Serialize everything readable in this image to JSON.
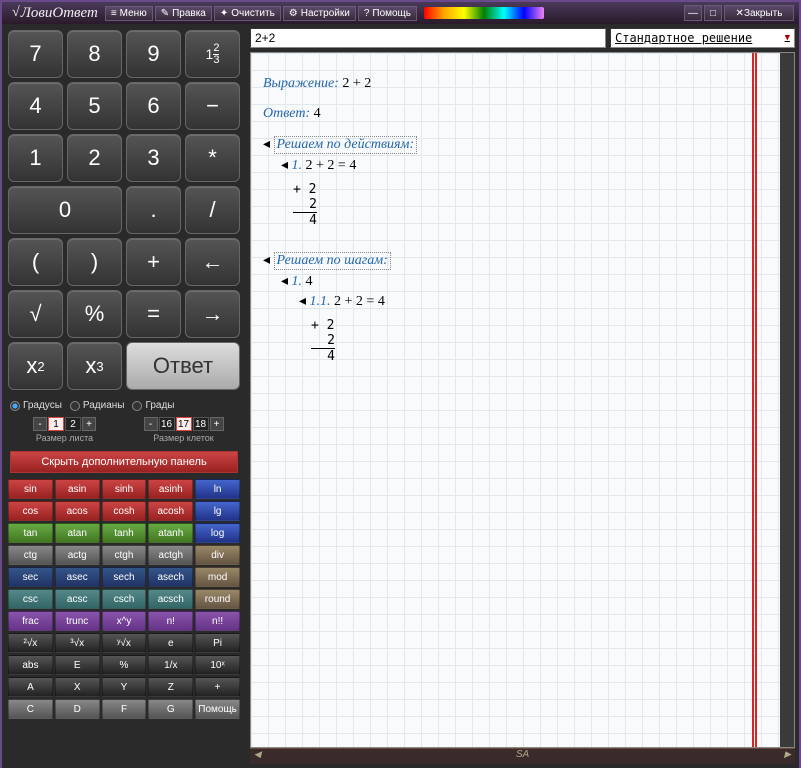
{
  "app": {
    "title": "ЛовиОтвет"
  },
  "menu": {
    "items": [
      "Меню",
      "Правка",
      "Очистить",
      "Настройки",
      "Помощь"
    ],
    "close": "Закрыть"
  },
  "keypad": {
    "rows": [
      [
        "7",
        "8",
        "9",
        "1⅔"
      ],
      [
        "4",
        "5",
        "6",
        "−"
      ],
      [
        "1",
        "2",
        "3",
        "*"
      ],
      [
        "0",
        "",
        ".",
        "/"
      ],
      [
        "(",
        ")",
        "+",
        "←"
      ],
      [
        "√",
        "%",
        "=",
        "→"
      ]
    ],
    "x2": "x",
    "x2_sup": "2",
    "x3": "x",
    "x3_sup": "3",
    "answer": "Ответ"
  },
  "angle": {
    "opts": [
      "Градусы",
      "Радианы",
      "Грады"
    ],
    "selected": 0
  },
  "sheet": {
    "label": "Размер листа",
    "vals": [
      "1",
      "2"
    ],
    "sel": 0
  },
  "cell": {
    "label": "Размер клеток",
    "vals": [
      "16",
      "17",
      "18"
    ],
    "sel": 1
  },
  "hide_panel": "Скрыть дополнительную панель",
  "fns": [
    [
      {
        "t": "sin",
        "c": "c-red"
      },
      {
        "t": "asin",
        "c": "c-red"
      },
      {
        "t": "sinh",
        "c": "c-red"
      },
      {
        "t": "asinh",
        "c": "c-red"
      },
      {
        "t": "ln",
        "c": "c-blue"
      }
    ],
    [
      {
        "t": "cos",
        "c": "c-red"
      },
      {
        "t": "acos",
        "c": "c-red"
      },
      {
        "t": "cosh",
        "c": "c-red"
      },
      {
        "t": "acosh",
        "c": "c-red"
      },
      {
        "t": "lg",
        "c": "c-blue"
      }
    ],
    [
      {
        "t": "tan",
        "c": "c-green"
      },
      {
        "t": "atan",
        "c": "c-green"
      },
      {
        "t": "tanh",
        "c": "c-green"
      },
      {
        "t": "atanh",
        "c": "c-green"
      },
      {
        "t": "log",
        "c": "c-blue"
      }
    ],
    [
      {
        "t": "ctg",
        "c": "c-gray"
      },
      {
        "t": "actg",
        "c": "c-gray"
      },
      {
        "t": "ctgh",
        "c": "c-gray"
      },
      {
        "t": "actgh",
        "c": "c-gray"
      },
      {
        "t": "div",
        "c": "c-brown"
      }
    ],
    [
      {
        "t": "sec",
        "c": "c-dblue"
      },
      {
        "t": "asec",
        "c": "c-dblue"
      },
      {
        "t": "sech",
        "c": "c-dblue"
      },
      {
        "t": "asech",
        "c": "c-dblue"
      },
      {
        "t": "mod",
        "c": "c-brown"
      }
    ],
    [
      {
        "t": "csc",
        "c": "c-teal"
      },
      {
        "t": "acsc",
        "c": "c-teal"
      },
      {
        "t": "csch",
        "c": "c-teal"
      },
      {
        "t": "acsch",
        "c": "c-teal"
      },
      {
        "t": "round",
        "c": "c-brown"
      }
    ],
    [
      {
        "t": "frac",
        "c": "c-purple"
      },
      {
        "t": "trunc",
        "c": "c-purple"
      },
      {
        "t": "x^y",
        "c": "c-purple"
      },
      {
        "t": "n!",
        "c": "c-purple"
      },
      {
        "t": "n!!",
        "c": "c-purple"
      }
    ],
    [
      {
        "t": "²√x",
        "c": "c-dark"
      },
      {
        "t": "³√x",
        "c": "c-dark"
      },
      {
        "t": "ʸ√x",
        "c": "c-dark"
      },
      {
        "t": "e",
        "c": "c-dark"
      },
      {
        "t": "Pi",
        "c": "c-dark"
      }
    ],
    [
      {
        "t": "abs",
        "c": "c-dark"
      },
      {
        "t": "E",
        "c": "c-dark"
      },
      {
        "t": "%",
        "c": "c-dark"
      },
      {
        "t": "1/x",
        "c": "c-dark"
      },
      {
        "t": "10ˣ",
        "c": "c-dark"
      }
    ],
    [
      {
        "t": "A",
        "c": "c-dark"
      },
      {
        "t": "X",
        "c": "c-dark"
      },
      {
        "t": "Y",
        "c": "c-dark"
      },
      {
        "t": "Z",
        "c": "c-dark"
      },
      {
        "t": "+",
        "c": "c-dark"
      }
    ],
    [
      {
        "t": "C",
        "c": "c-gray"
      },
      {
        "t": "D",
        "c": "c-gray"
      },
      {
        "t": "F",
        "c": "c-gray"
      },
      {
        "t": "G",
        "c": "c-gray"
      },
      {
        "t": "Помощь",
        "c": "c-gray"
      }
    ]
  ],
  "input": {
    "expr": "2+2",
    "mode": "Стандартное решение"
  },
  "solution": {
    "expr_lbl": "Выражение:",
    "expr": "2 + 2",
    "ans_lbl": "Ответ:",
    "ans": "4",
    "sect1": "Решаем по действиям:",
    "step1_num": "1.",
    "step1": "2 + 2 = 4",
    "calc_top": "+ 2",
    "calc_mid": "2",
    "calc_bot": "4",
    "sect2": "Решаем по шагам:",
    "step2_num": "1.",
    "step2": "4",
    "step2_1_num": "1.1.",
    "step2_1": "2 + 2 = 4"
  },
  "footer": "SA"
}
